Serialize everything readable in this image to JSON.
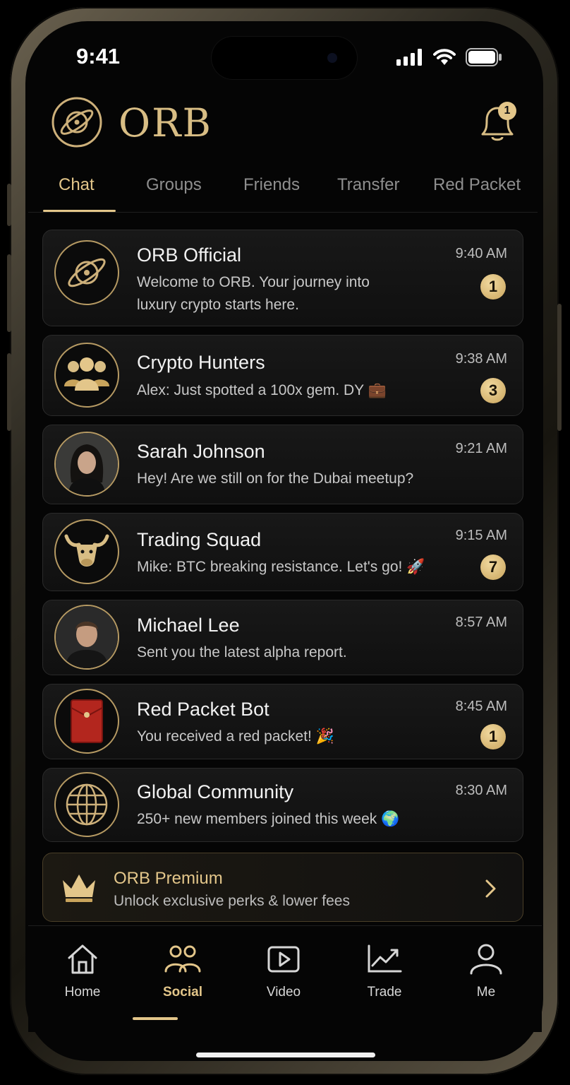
{
  "status": {
    "time": "9:41"
  },
  "header": {
    "brand": "ORB",
    "notification_count": "1"
  },
  "tabs": [
    {
      "label": "Chat",
      "active": true
    },
    {
      "label": "Groups"
    },
    {
      "label": "Friends"
    },
    {
      "label": "Transfer"
    },
    {
      "label": "Red Packet"
    }
  ],
  "chats": [
    {
      "name": "ORB Official",
      "message": "Welcome to ORB. Your journey into luxury crypto starts here.",
      "time": "9:40 AM",
      "unread": "1",
      "avatar": "planet-logo-icon"
    },
    {
      "name": "Crypto Hunters",
      "message": "Alex: Just spotted a 100x gem. DY 💼",
      "time": "9:38 AM",
      "unread": "3",
      "avatar": "group-icon"
    },
    {
      "name": "Sarah Johnson",
      "message": "Hey! Are we still on for the Dubai meetup?",
      "time": "9:21 AM",
      "unread": "",
      "avatar": "user-photo-female"
    },
    {
      "name": "Trading Squad",
      "message": "Mike: BTC breaking resistance. Let's go! 🚀",
      "time": "9:15 AM",
      "unread": "7",
      "avatar": "bull-icon"
    },
    {
      "name": "Michael Lee",
      "message": "Sent you the latest alpha report.",
      "time": "8:57 AM",
      "unread": "",
      "avatar": "user-photo-male"
    },
    {
      "name": "Red Packet Bot",
      "message": "You received a red packet! 🎉",
      "time": "8:45 AM",
      "unread": "1",
      "avatar": "red-envelope-icon"
    },
    {
      "name": "Global Community",
      "message": "250+ new members joined this week 🌍",
      "time": "8:30 AM",
      "unread": "",
      "avatar": "globe-icon"
    }
  ],
  "premium": {
    "title": "ORB Premium",
    "subtitle": "Unlock exclusive perks & lower fees"
  },
  "nav": [
    {
      "label": "Home",
      "icon": "home-icon"
    },
    {
      "label": "Social",
      "icon": "people-icon",
      "active": true
    },
    {
      "label": "Video",
      "icon": "play-icon"
    },
    {
      "label": "Trade",
      "icon": "chart-icon"
    },
    {
      "label": "Me",
      "icon": "person-icon"
    }
  ],
  "colors": {
    "accent": "#e3c68a",
    "background": "#050505",
    "card": "#141414"
  }
}
